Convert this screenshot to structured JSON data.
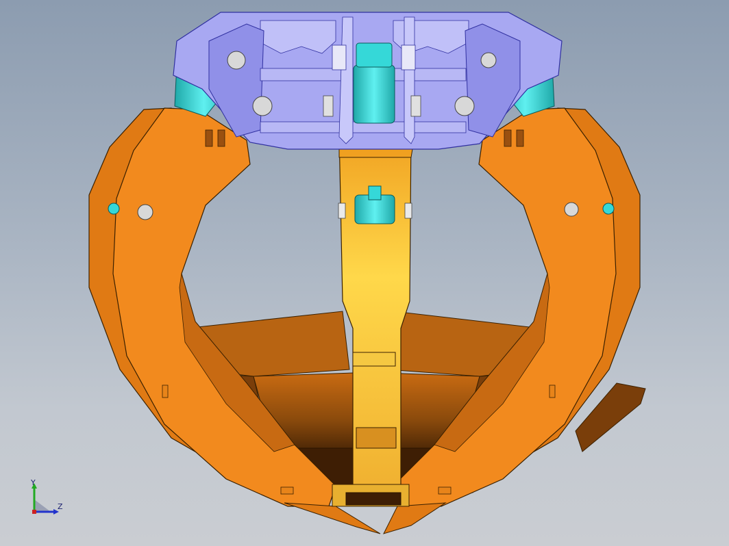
{
  "viewport": {
    "background_top": "#8c9cb0",
    "background_bottom": "#cacdd2"
  },
  "colors": {
    "claw_orange": "#f08a1c",
    "claw_shadow": "#a85a10",
    "claw_dark": "#5a2e08",
    "claw_edge": "#3a2000",
    "bracket_purple": "#9898ee",
    "bracket_dark": "#6060c0",
    "cylinder_cyan": "#35d8d8",
    "center_yellow": "#f5c842"
  },
  "triad": {
    "y_label": "Y",
    "z_label": "Z",
    "y_color": "#22aa22",
    "z_color": "#2233cc",
    "x_color": "#cc2222"
  }
}
